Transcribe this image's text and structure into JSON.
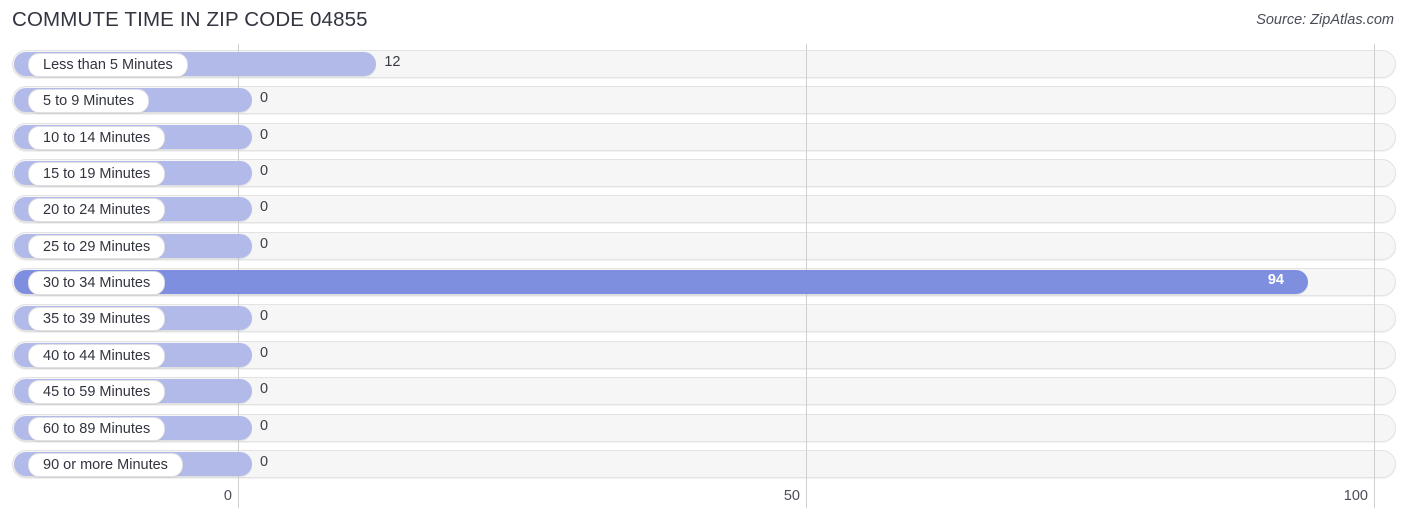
{
  "header": {
    "title": "COMMUTE TIME IN ZIP CODE 04855",
    "source": "Source: ZipAtlas.com"
  },
  "colors": {
    "bar": "#b2bae9",
    "bar_highlight": "#7e8fdf",
    "track": "#f6f6f6",
    "grid": "#cfcfcf",
    "text": "#32343f"
  },
  "chart_data": {
    "type": "bar",
    "orientation": "horizontal",
    "title": "COMMUTE TIME IN ZIP CODE 04855",
    "subtitle": "",
    "xlabel": "",
    "ylabel": "",
    "xlim": [
      0,
      100
    ],
    "ticks": [
      "0",
      "50",
      "100"
    ],
    "tick_values": [
      0,
      50,
      100
    ],
    "grid": true,
    "legend": null,
    "highlight_category": "30 to 34 Minutes",
    "categories": [
      "Less than 5 Minutes",
      "5 to 9 Minutes",
      "10 to 14 Minutes",
      "15 to 19 Minutes",
      "20 to 24 Minutes",
      "25 to 29 Minutes",
      "30 to 34 Minutes",
      "35 to 39 Minutes",
      "40 to 44 Minutes",
      "45 to 59 Minutes",
      "60 to 89 Minutes",
      "90 or more Minutes"
    ],
    "values": [
      12,
      0,
      0,
      0,
      0,
      0,
      94,
      0,
      0,
      0,
      0,
      0
    ],
    "value_labels": [
      "12",
      "0",
      "0",
      "0",
      "0",
      "0",
      "94",
      "0",
      "0",
      "0",
      "0",
      "0"
    ],
    "rows": [
      {
        "label": "Less than 5 Minutes",
        "value": 12,
        "value_label": "12",
        "highlight": false
      },
      {
        "label": "5 to 9 Minutes",
        "value": 0,
        "value_label": "0",
        "highlight": false
      },
      {
        "label": "10 to 14 Minutes",
        "value": 0,
        "value_label": "0",
        "highlight": false
      },
      {
        "label": "15 to 19 Minutes",
        "value": 0,
        "value_label": "0",
        "highlight": false
      },
      {
        "label": "20 to 24 Minutes",
        "value": 0,
        "value_label": "0",
        "highlight": false
      },
      {
        "label": "25 to 29 Minutes",
        "value": 0,
        "value_label": "0",
        "highlight": false
      },
      {
        "label": "30 to 34 Minutes",
        "value": 94,
        "value_label": "94",
        "highlight": true
      },
      {
        "label": "35 to 39 Minutes",
        "value": 0,
        "value_label": "0",
        "highlight": false
      },
      {
        "label": "40 to 44 Minutes",
        "value": 0,
        "value_label": "0",
        "highlight": false
      },
      {
        "label": "45 to 59 Minutes",
        "value": 0,
        "value_label": "0",
        "highlight": false
      },
      {
        "label": "60 to 89 Minutes",
        "value": 0,
        "value_label": "0",
        "highlight": false
      },
      {
        "label": "90 or more Minutes",
        "value": 0,
        "value_label": "0",
        "highlight": false
      }
    ]
  }
}
